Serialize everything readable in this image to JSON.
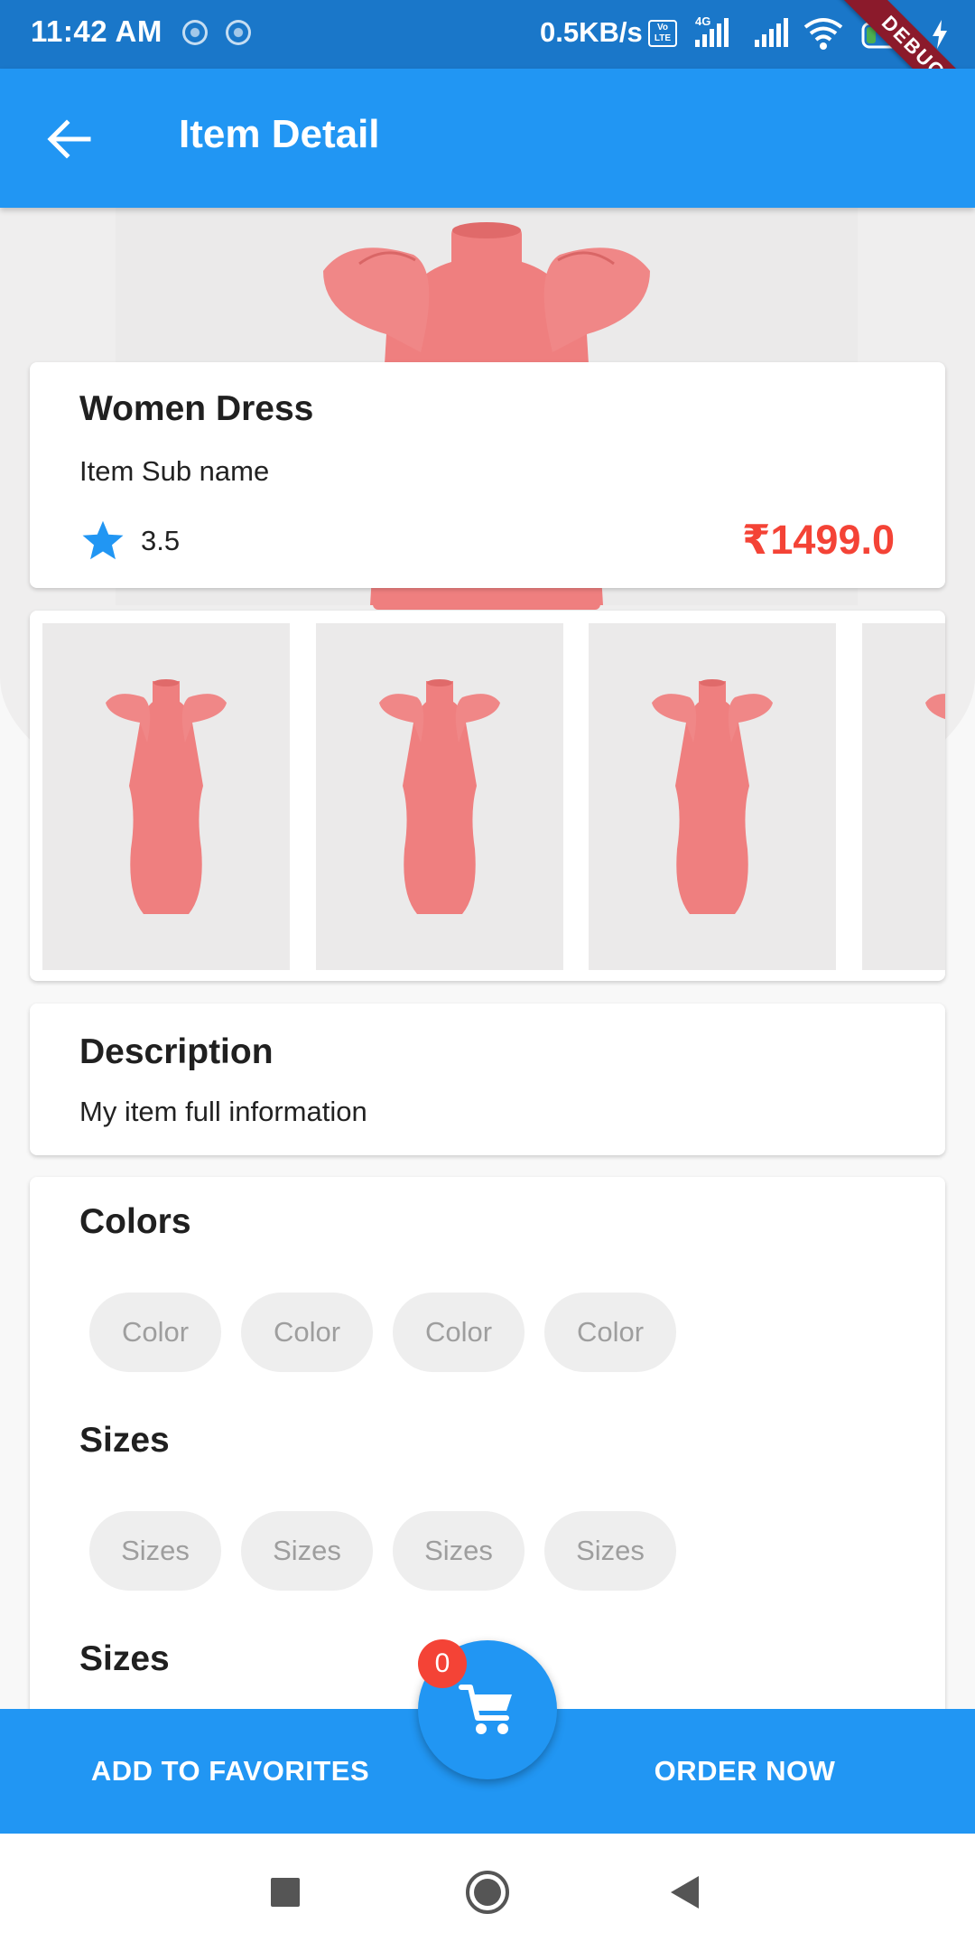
{
  "status_bar": {
    "time": "11:42 AM",
    "net_speed": "0.5KB/s",
    "volte_top": "Vo",
    "volte_bottom": "LTE",
    "network_type": "4G",
    "battery_level": "12",
    "debug_label": "DEBUG"
  },
  "app_bar": {
    "title": "Item Detail",
    "back_icon": "arrow-back-icon"
  },
  "item": {
    "name": "Women Dress",
    "sub_name": "Item Sub name",
    "rating": "3.5",
    "price": "₹1499.0"
  },
  "gallery": {
    "thumbnail_count": 4
  },
  "description": {
    "title": "Description",
    "text": "My item full information"
  },
  "colors": {
    "title": "Colors",
    "chips": [
      "Color",
      "Color",
      "Color",
      "Color"
    ]
  },
  "sizes": {
    "title": "Sizes",
    "chips": [
      "Sizes",
      "Sizes",
      "Sizes",
      "Sizes"
    ]
  },
  "sizes_second": {
    "title": "Sizes"
  },
  "bottom_bar": {
    "favorites_label": "ADD TO FAVORITES",
    "order_label": "ORDER NOW",
    "cart_count": "0"
  },
  "colors_palette": {
    "primary": "#2196f3",
    "status_bar": "#1a77c9",
    "price": "#f44336",
    "badge": "#f44336",
    "dress": "#ef7f7f"
  }
}
